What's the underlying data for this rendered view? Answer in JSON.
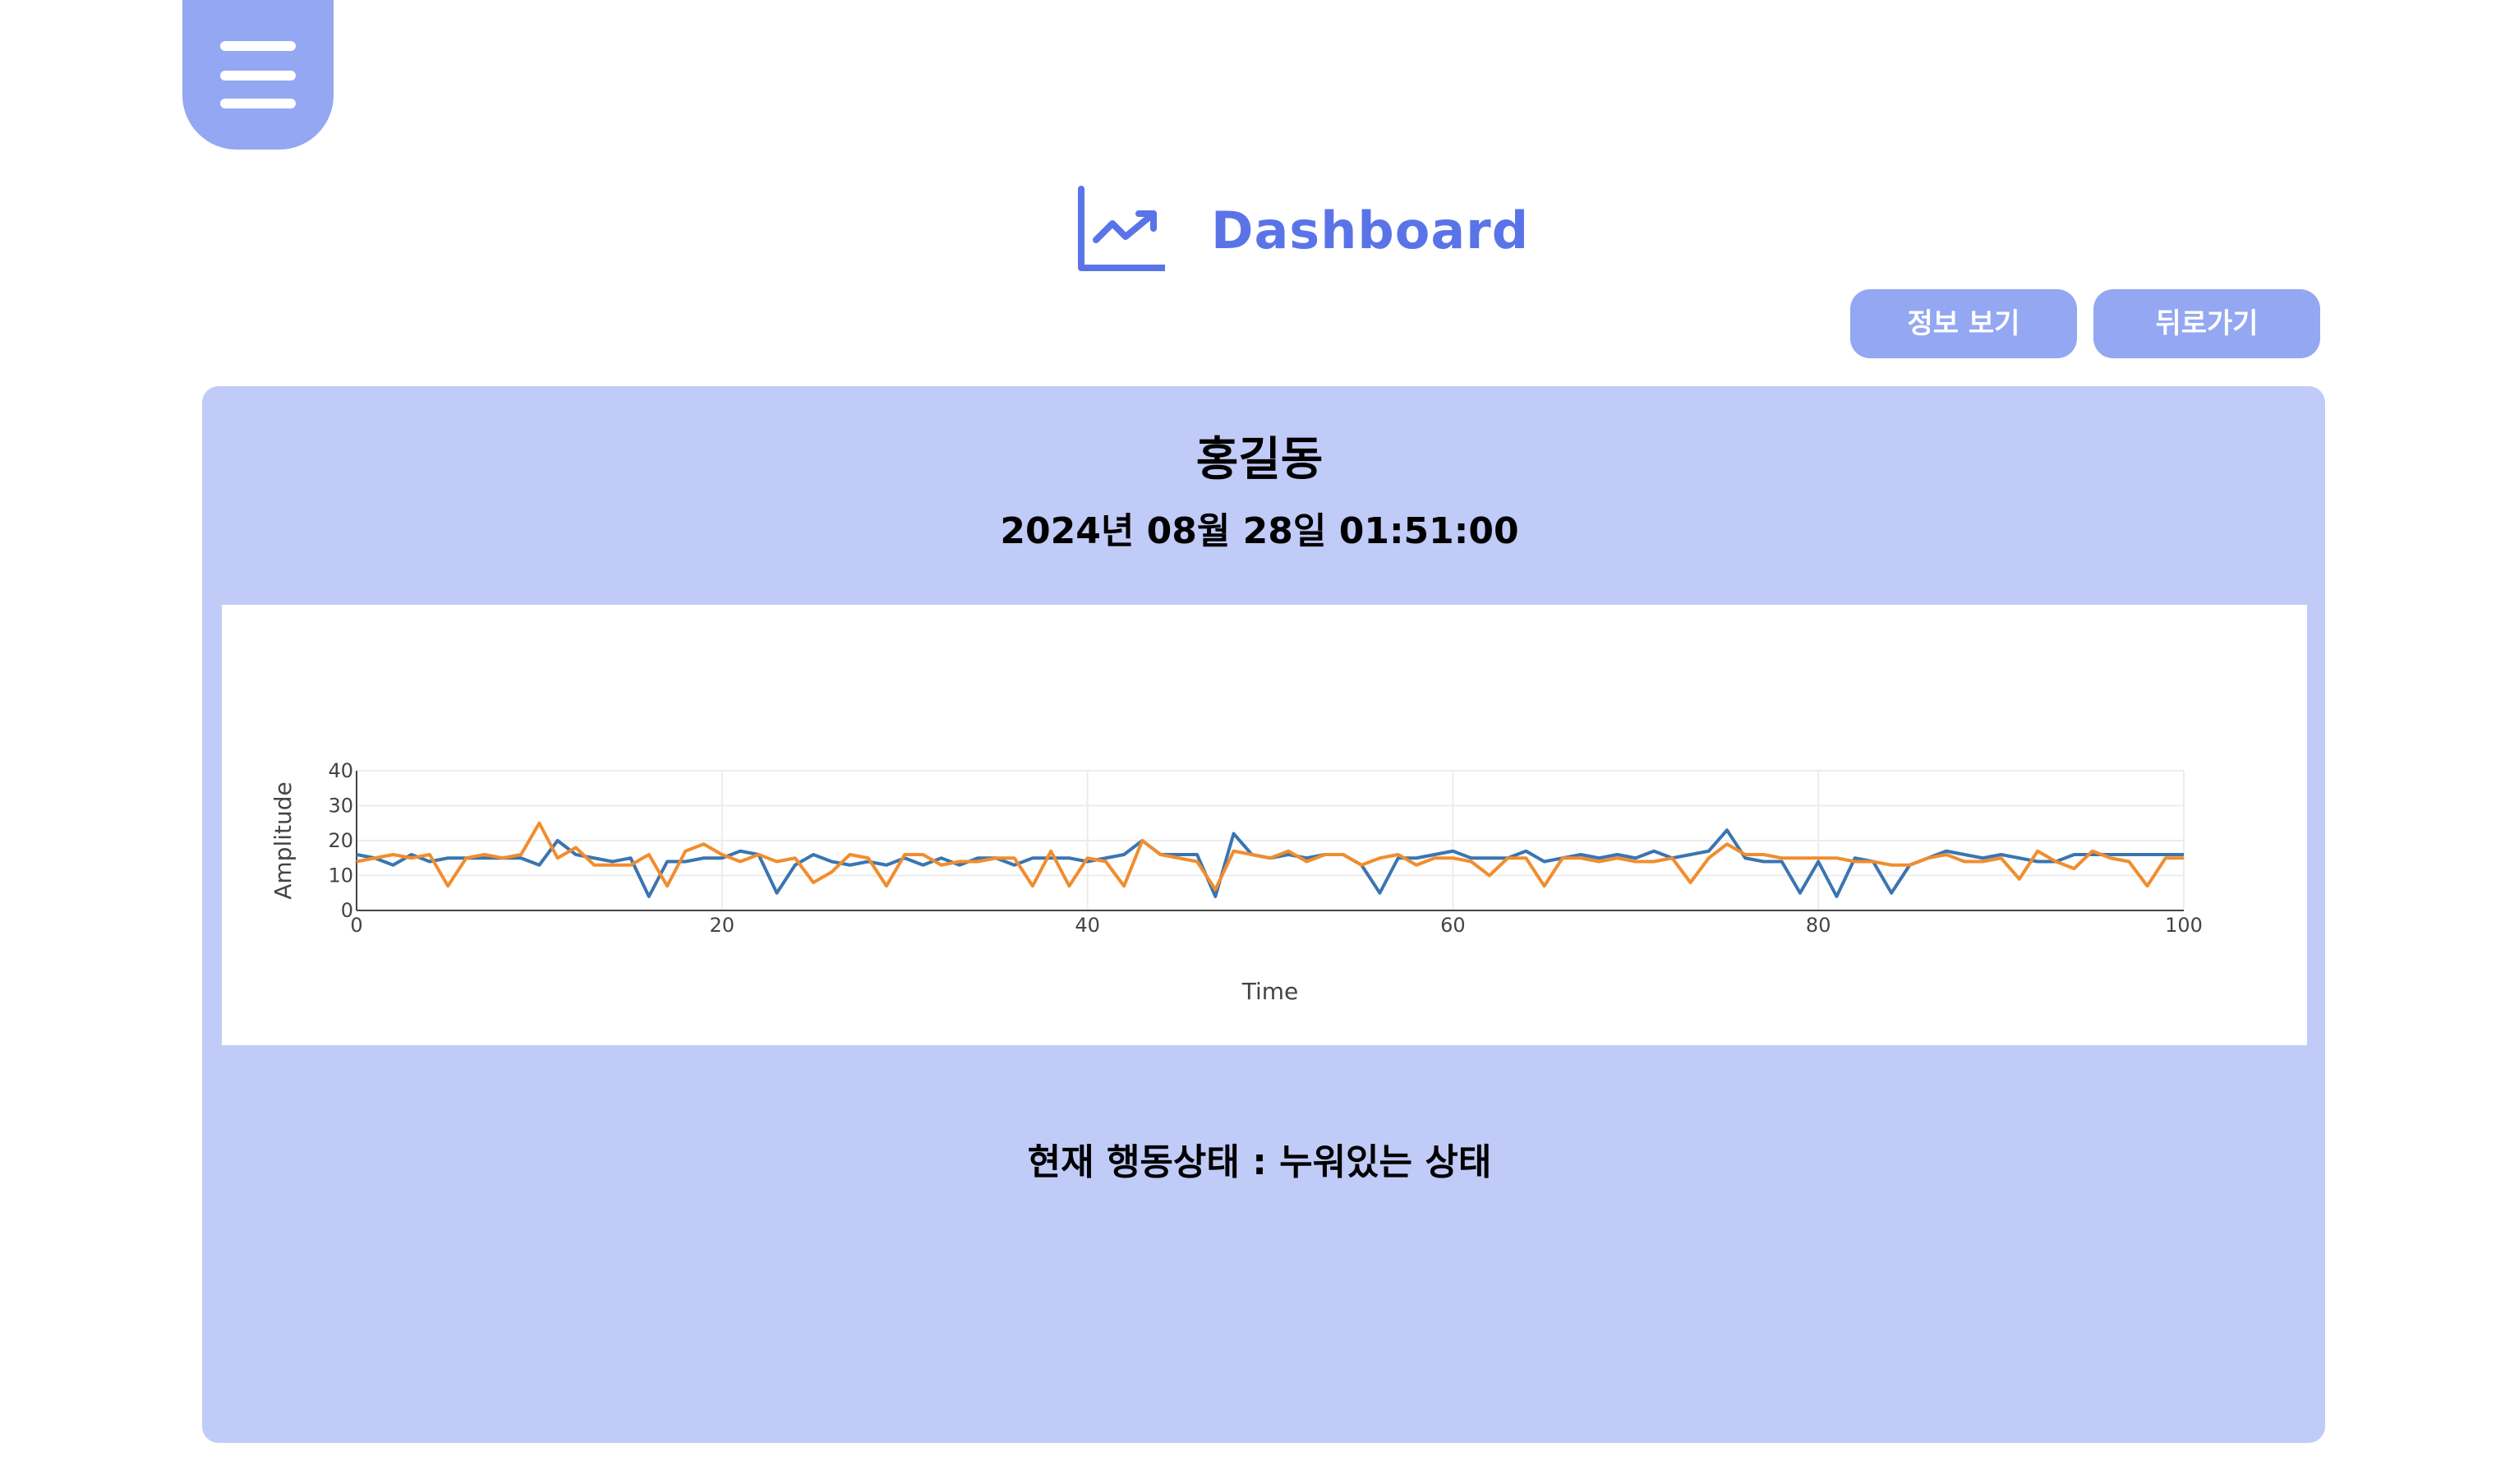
{
  "menu": {
    "icon": "hamburger-menu-icon"
  },
  "header": {
    "icon": "trending-chart-icon",
    "title": "Dashboard",
    "accent_color": "#5a74e8"
  },
  "toolbar": {
    "info_label": "정보 보기",
    "back_label": "뒤로가기",
    "button_color": "#94a7f3"
  },
  "card": {
    "name": "홍길동",
    "timestamp": "2024년 08월 28일 01:51:00",
    "status": "현재 행동상태 : 누워있는 상태",
    "background_color": "#c1cbf7"
  },
  "chart_data": {
    "type": "line",
    "title": "",
    "xlabel": "Time",
    "ylabel": "Amplitude",
    "xlim": [
      0,
      100
    ],
    "ylim": [
      0,
      40
    ],
    "x_ticks": [
      0,
      20,
      40,
      60,
      80,
      100
    ],
    "y_ticks": [
      0,
      10,
      20,
      30,
      40
    ],
    "grid": true,
    "legend": "none",
    "series": [
      {
        "color": "#3a75b0",
        "values": [
          16,
          15,
          13,
          16,
          14,
          15,
          15,
          15,
          15,
          15,
          13,
          20,
          16,
          15,
          14,
          15,
          4,
          14,
          14,
          15,
          15,
          17,
          16,
          5,
          13,
          16,
          14,
          13,
          14,
          13,
          15,
          13,
          15,
          13,
          15,
          15,
          13,
          15,
          15,
          15,
          14,
          15,
          16,
          20,
          16,
          16,
          16,
          4,
          22,
          16,
          15,
          16,
          15,
          16,
          16,
          13,
          5,
          15,
          15,
          16,
          17,
          15,
          15,
          15,
          17,
          14,
          15,
          16,
          15,
          16,
          15,
          17,
          15,
          16,
          17,
          23,
          15,
          14,
          14,
          5,
          14,
          4,
          15,
          14,
          5,
          13,
          15,
          17,
          16,
          15,
          16,
          15,
          14,
          14,
          16,
          16,
          16,
          16,
          16,
          16,
          16
        ]
      },
      {
        "color": "#f18d2e",
        "values": [
          14,
          15,
          16,
          15,
          16,
          7,
          15,
          16,
          15,
          16,
          25,
          15,
          18,
          13,
          13,
          13,
          16,
          7,
          17,
          19,
          16,
          14,
          16,
          14,
          15,
          8,
          11,
          16,
          15,
          7,
          16,
          16,
          13,
          14,
          14,
          15,
          15,
          7,
          17,
          7,
          15,
          14,
          7,
          20,
          16,
          15,
          14,
          6,
          17,
          16,
          15,
          17,
          14,
          16,
          16,
          13,
          15,
          16,
          13,
          15,
          15,
          14,
          10,
          15,
          15,
          7,
          15,
          15,
          14,
          15,
          14,
          14,
          15,
          8,
          15,
          19,
          16,
          16,
          15,
          15,
          15,
          15,
          14,
          14,
          13,
          13,
          15,
          16,
          14,
          14,
          15,
          9,
          17,
          14,
          12,
          17,
          15,
          14,
          7,
          15,
          15
        ]
      }
    ]
  }
}
